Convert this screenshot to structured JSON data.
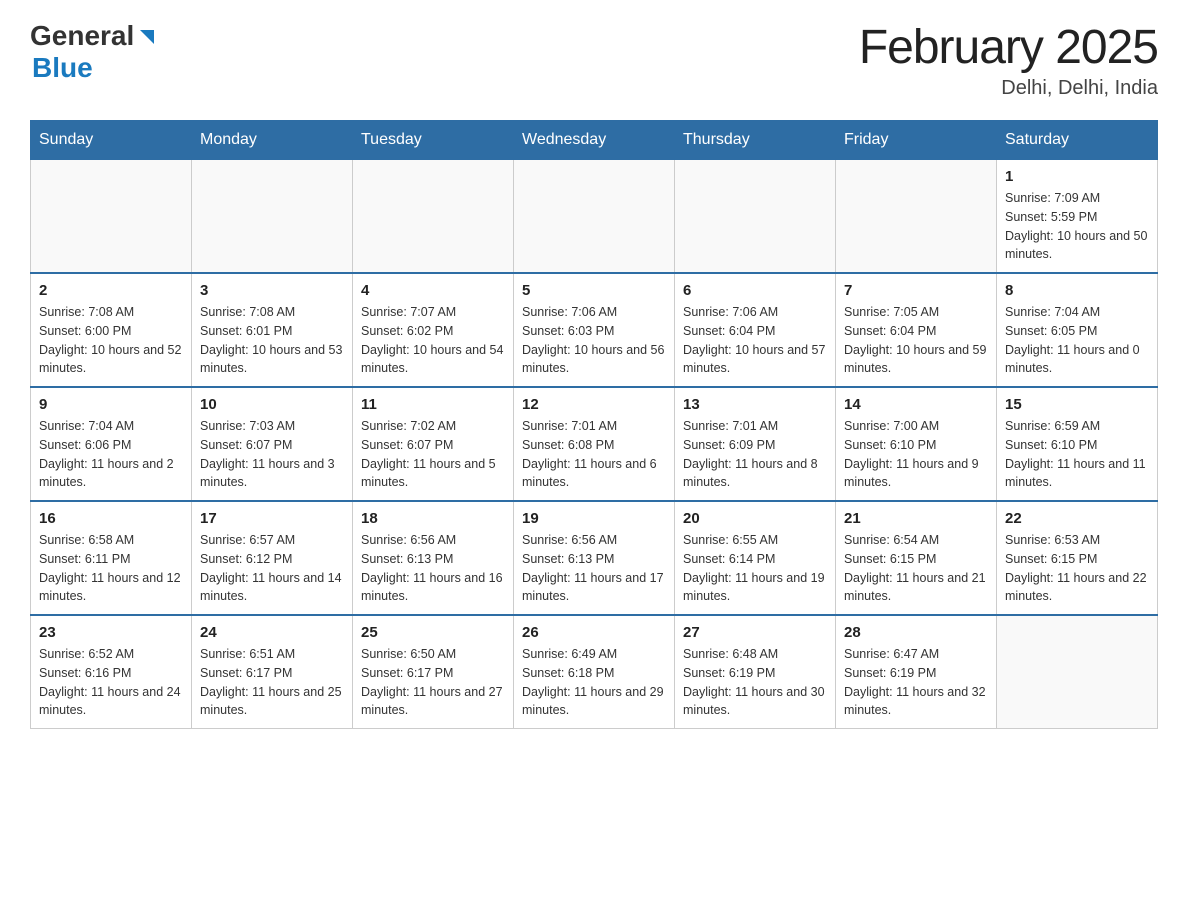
{
  "header": {
    "logo_general": "General",
    "logo_blue": "Blue",
    "title": "February 2025",
    "subtitle": "Delhi, Delhi, India"
  },
  "weekdays": [
    "Sunday",
    "Monday",
    "Tuesday",
    "Wednesday",
    "Thursday",
    "Friday",
    "Saturday"
  ],
  "weeks": [
    [
      {
        "day": "",
        "info": ""
      },
      {
        "day": "",
        "info": ""
      },
      {
        "day": "",
        "info": ""
      },
      {
        "day": "",
        "info": ""
      },
      {
        "day": "",
        "info": ""
      },
      {
        "day": "",
        "info": ""
      },
      {
        "day": "1",
        "info": "Sunrise: 7:09 AM\nSunset: 5:59 PM\nDaylight: 10 hours and 50 minutes."
      }
    ],
    [
      {
        "day": "2",
        "info": "Sunrise: 7:08 AM\nSunset: 6:00 PM\nDaylight: 10 hours and 52 minutes."
      },
      {
        "day": "3",
        "info": "Sunrise: 7:08 AM\nSunset: 6:01 PM\nDaylight: 10 hours and 53 minutes."
      },
      {
        "day": "4",
        "info": "Sunrise: 7:07 AM\nSunset: 6:02 PM\nDaylight: 10 hours and 54 minutes."
      },
      {
        "day": "5",
        "info": "Sunrise: 7:06 AM\nSunset: 6:03 PM\nDaylight: 10 hours and 56 minutes."
      },
      {
        "day": "6",
        "info": "Sunrise: 7:06 AM\nSunset: 6:04 PM\nDaylight: 10 hours and 57 minutes."
      },
      {
        "day": "7",
        "info": "Sunrise: 7:05 AM\nSunset: 6:04 PM\nDaylight: 10 hours and 59 minutes."
      },
      {
        "day": "8",
        "info": "Sunrise: 7:04 AM\nSunset: 6:05 PM\nDaylight: 11 hours and 0 minutes."
      }
    ],
    [
      {
        "day": "9",
        "info": "Sunrise: 7:04 AM\nSunset: 6:06 PM\nDaylight: 11 hours and 2 minutes."
      },
      {
        "day": "10",
        "info": "Sunrise: 7:03 AM\nSunset: 6:07 PM\nDaylight: 11 hours and 3 minutes."
      },
      {
        "day": "11",
        "info": "Sunrise: 7:02 AM\nSunset: 6:07 PM\nDaylight: 11 hours and 5 minutes."
      },
      {
        "day": "12",
        "info": "Sunrise: 7:01 AM\nSunset: 6:08 PM\nDaylight: 11 hours and 6 minutes."
      },
      {
        "day": "13",
        "info": "Sunrise: 7:01 AM\nSunset: 6:09 PM\nDaylight: 11 hours and 8 minutes."
      },
      {
        "day": "14",
        "info": "Sunrise: 7:00 AM\nSunset: 6:10 PM\nDaylight: 11 hours and 9 minutes."
      },
      {
        "day": "15",
        "info": "Sunrise: 6:59 AM\nSunset: 6:10 PM\nDaylight: 11 hours and 11 minutes."
      }
    ],
    [
      {
        "day": "16",
        "info": "Sunrise: 6:58 AM\nSunset: 6:11 PM\nDaylight: 11 hours and 12 minutes."
      },
      {
        "day": "17",
        "info": "Sunrise: 6:57 AM\nSunset: 6:12 PM\nDaylight: 11 hours and 14 minutes."
      },
      {
        "day": "18",
        "info": "Sunrise: 6:56 AM\nSunset: 6:13 PM\nDaylight: 11 hours and 16 minutes."
      },
      {
        "day": "19",
        "info": "Sunrise: 6:56 AM\nSunset: 6:13 PM\nDaylight: 11 hours and 17 minutes."
      },
      {
        "day": "20",
        "info": "Sunrise: 6:55 AM\nSunset: 6:14 PM\nDaylight: 11 hours and 19 minutes."
      },
      {
        "day": "21",
        "info": "Sunrise: 6:54 AM\nSunset: 6:15 PM\nDaylight: 11 hours and 21 minutes."
      },
      {
        "day": "22",
        "info": "Sunrise: 6:53 AM\nSunset: 6:15 PM\nDaylight: 11 hours and 22 minutes."
      }
    ],
    [
      {
        "day": "23",
        "info": "Sunrise: 6:52 AM\nSunset: 6:16 PM\nDaylight: 11 hours and 24 minutes."
      },
      {
        "day": "24",
        "info": "Sunrise: 6:51 AM\nSunset: 6:17 PM\nDaylight: 11 hours and 25 minutes."
      },
      {
        "day": "25",
        "info": "Sunrise: 6:50 AM\nSunset: 6:17 PM\nDaylight: 11 hours and 27 minutes."
      },
      {
        "day": "26",
        "info": "Sunrise: 6:49 AM\nSunset: 6:18 PM\nDaylight: 11 hours and 29 minutes."
      },
      {
        "day": "27",
        "info": "Sunrise: 6:48 AM\nSunset: 6:19 PM\nDaylight: 11 hours and 30 minutes."
      },
      {
        "day": "28",
        "info": "Sunrise: 6:47 AM\nSunset: 6:19 PM\nDaylight: 11 hours and 32 minutes."
      },
      {
        "day": "",
        "info": ""
      }
    ]
  ]
}
